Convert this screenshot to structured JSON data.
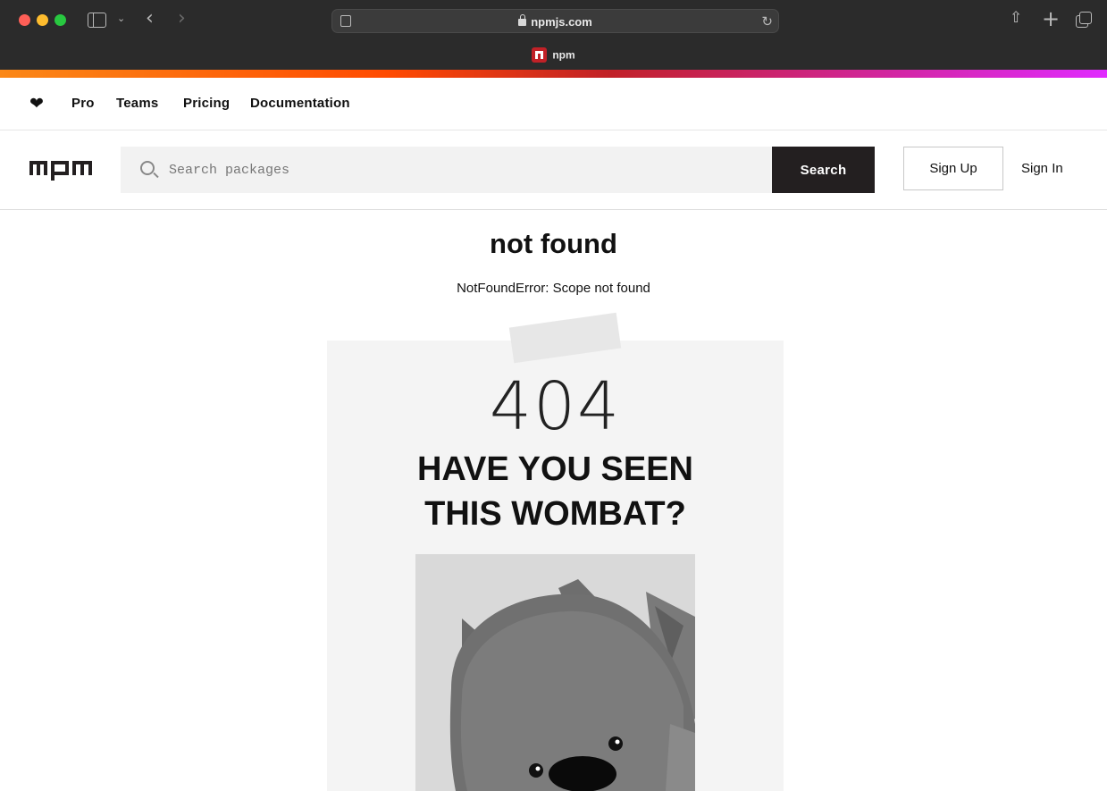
{
  "browser": {
    "url": "npmjs.com",
    "tab_title": "npm"
  },
  "topnav": {
    "items": [
      {
        "label": "Pro"
      },
      {
        "label": "Teams"
      },
      {
        "label": "Pricing"
      },
      {
        "label": "Documentation"
      }
    ]
  },
  "header": {
    "search_placeholder": "Search packages",
    "search_button": "Search",
    "signup": "Sign Up",
    "signin": "Sign In"
  },
  "main": {
    "title": "not found",
    "error": "NotFoundError: Scope not found",
    "poster": {
      "code": "404",
      "headline_line1": "HAVE YOU SEEN",
      "headline_line2": "THIS WOMBAT?"
    }
  },
  "colors": {
    "accent_dark": "#231f20",
    "npm_red": "#c12127",
    "gradient": [
      "#fb8817",
      "#ff4b01",
      "#c12127",
      "#e02aff"
    ]
  },
  "icons": [
    "heart-icon",
    "search-icon",
    "npm-logo",
    "lock-icon",
    "reload-icon",
    "share-icon",
    "new-tab-icon",
    "tab-overview-icon",
    "sidebar-icon",
    "back-icon",
    "forward-icon"
  ]
}
